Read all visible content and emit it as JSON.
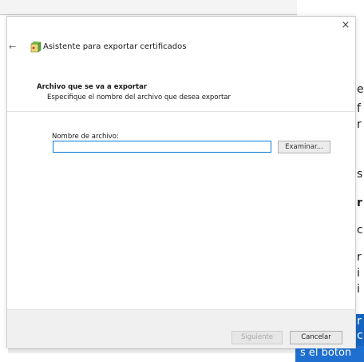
{
  "dialog": {
    "title": "Asistente para exportar certificados",
    "close_label": "×",
    "back_label": "←"
  },
  "section": {
    "heading": "Archivo que se va a exportar",
    "description": "Especifique el nombre del archivo que desea exportar"
  },
  "form": {
    "filename_label": "Nombre de archivo:",
    "filename_value": "",
    "browse_label": "Examinar..."
  },
  "footer": {
    "next_label": "Siguiente",
    "cancel_label": "Cancelar"
  },
  "background": {
    "right_chars": [
      "e",
      "f",
      "r",
      "s",
      "r",
      "c",
      "r",
      "i",
      "i",
      "r",
      "c"
    ],
    "bottom_text": "s el boton"
  },
  "colors": {
    "accent": "#0a78d7",
    "footer_bg": "#f0f0f0",
    "background_blue": "#1e6fd0"
  },
  "icons": {
    "wizard": "certificate-wizard-icon",
    "close": "close-icon",
    "back": "back-arrow-icon"
  }
}
